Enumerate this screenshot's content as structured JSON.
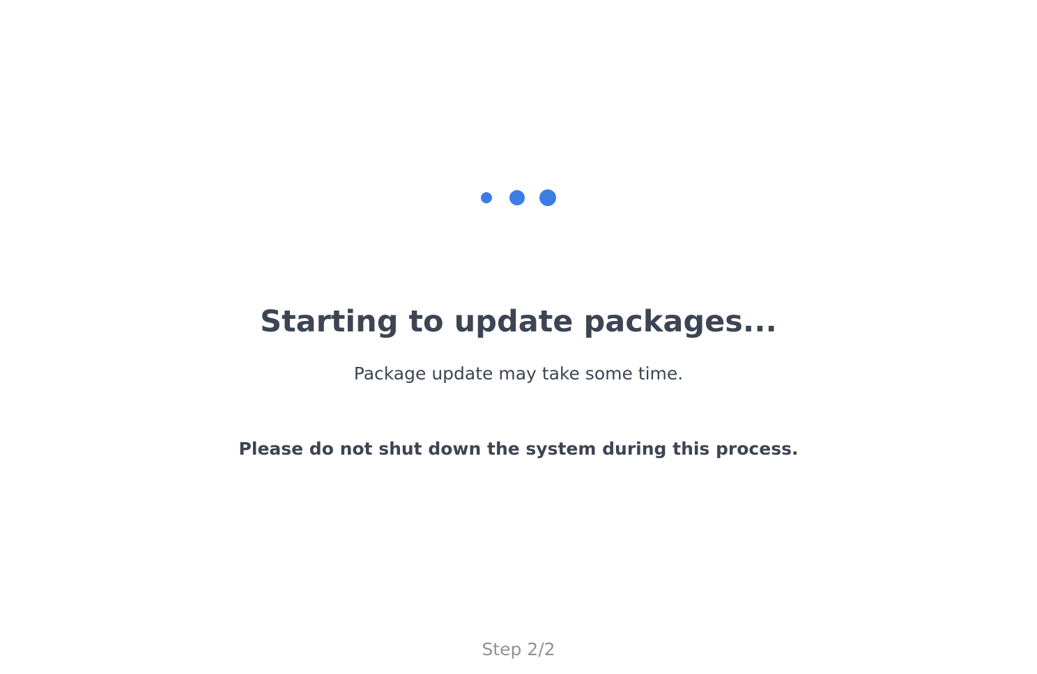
{
  "loader": {
    "dots": 3,
    "color": "#3b7de3",
    "icon": "loading-dots-icon"
  },
  "main": {
    "title": "Starting to update packages...",
    "subtitle": "Package update may take some time.",
    "warning": "Please do not shut down the system during this process."
  },
  "footer": {
    "step": "Step 2/2"
  },
  "colors": {
    "text": "#3d4553",
    "muted": "#8e9196",
    "background": "#ffffff"
  }
}
